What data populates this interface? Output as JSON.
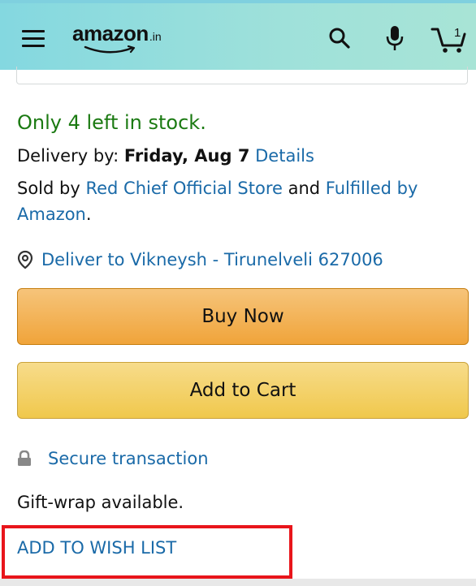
{
  "header": {
    "logo_text": "amazon",
    "logo_suffix": ".in",
    "cart_count": "1",
    "icons": [
      "menu-icon",
      "search-icon",
      "mic-icon",
      "cart-icon"
    ]
  },
  "product": {
    "stock_text": "Only 4 left in stock.",
    "delivery_label": "Delivery by: ",
    "delivery_date": "Friday, Aug 7",
    "delivery_details": "Details",
    "sold_by_prefix": "Sold by ",
    "seller": "Red Chief Official Store",
    "sold_by_and": " and ",
    "fulfilled_by": "Fulfilled by",
    "fulfilled_amazon": "Amazon",
    "fulfilled_period": ".",
    "deliver_to": "Deliver to Vikneysh - Tirunelveli 627006"
  },
  "actions": {
    "buy_now": "Buy Now",
    "add_to_cart": "Add to Cart",
    "secure_transaction": "Secure transaction",
    "gift_wrap": "Gift-wrap available.",
    "add_to_wish_list": "ADD TO WISH LIST"
  },
  "colors": {
    "header_bg": "#9fe1da",
    "stock_green": "#1b7a12",
    "link_blue": "#1a6aa8",
    "buy_now_bg": "#f0a43a",
    "add_cart_bg": "#f0c84c",
    "highlight_red": "#e8151b"
  }
}
